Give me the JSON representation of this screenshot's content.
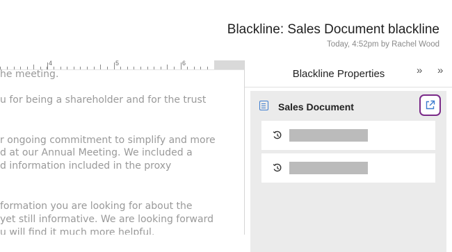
{
  "header": {
    "title": "Blackline: Sales Document blackline",
    "subtitle": "Today, 4:52pm by Rachel Wood"
  },
  "ruler": {
    "labels": [
      "4",
      "5",
      "6"
    ]
  },
  "document": {
    "lines": [
      "he meeting.",
      "u for being a shareholder and for the trust",
      "r ongoing commitment to simplify and more",
      "d at our Annual Meeting. We included a",
      "d information included in the proxy",
      "formation you are looking for about the",
      "yet still informative. We are looking forward",
      "u will find it much more helpful."
    ]
  },
  "panel": {
    "title": "Blackline Properties",
    "collapse_glyph": "»",
    "document_name": "Sales Document",
    "versions": [
      {
        "icon": "history-icon"
      },
      {
        "icon": "history-icon"
      }
    ]
  },
  "colors": {
    "accent_outline": "#7a2a88",
    "icon_blue": "#3c7ccf",
    "placeholder_gray": "#bbbbbb",
    "card_bg": "#ebebeb"
  }
}
